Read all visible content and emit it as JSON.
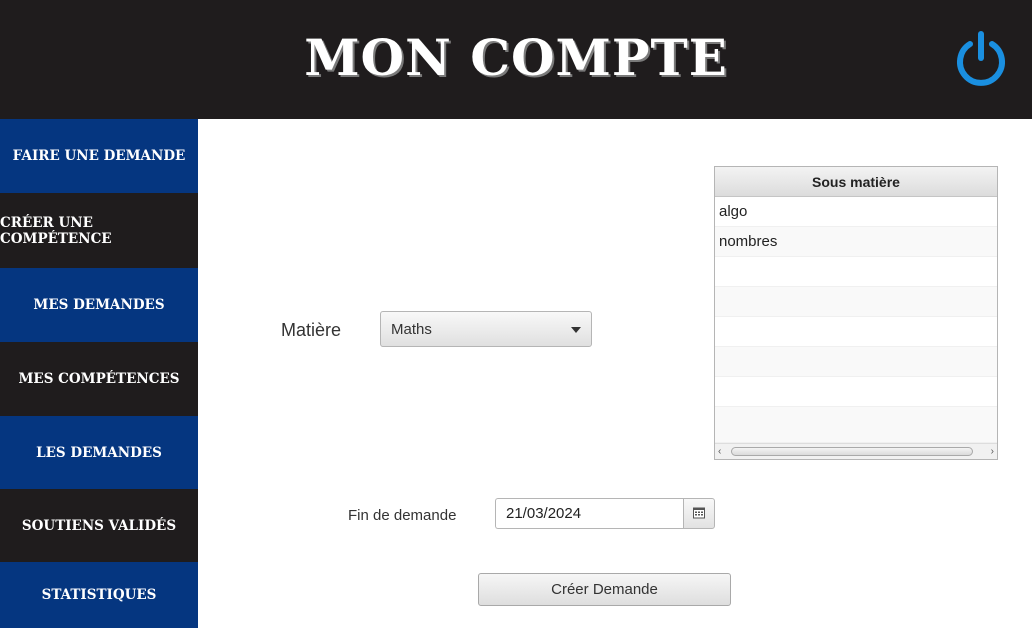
{
  "header": {
    "title": "MON COMPTE",
    "power_icon": "power-icon",
    "accent": "#1a8fe0"
  },
  "sidebar": {
    "items": [
      {
        "label": "Faire une demande"
      },
      {
        "label": "Créer une compétence"
      },
      {
        "label": "Mes demandes"
      },
      {
        "label": "Mes compétences"
      },
      {
        "label": "Les demandes"
      },
      {
        "label": "Soutiens validés"
      },
      {
        "label": "Statistiques"
      }
    ],
    "colors": {
      "blue": "#053680",
      "dark": "#1f1c1d"
    }
  },
  "form": {
    "matiere_label": "Matière",
    "matiere_value": "Maths",
    "fin_label": "Fin de demande",
    "fin_value": "21/03/2024",
    "submit_label": "Créer Demande"
  },
  "table": {
    "header": "Sous matière",
    "rows": [
      "algo",
      "nombres",
      "",
      "",
      "",
      "",
      "",
      ""
    ]
  }
}
